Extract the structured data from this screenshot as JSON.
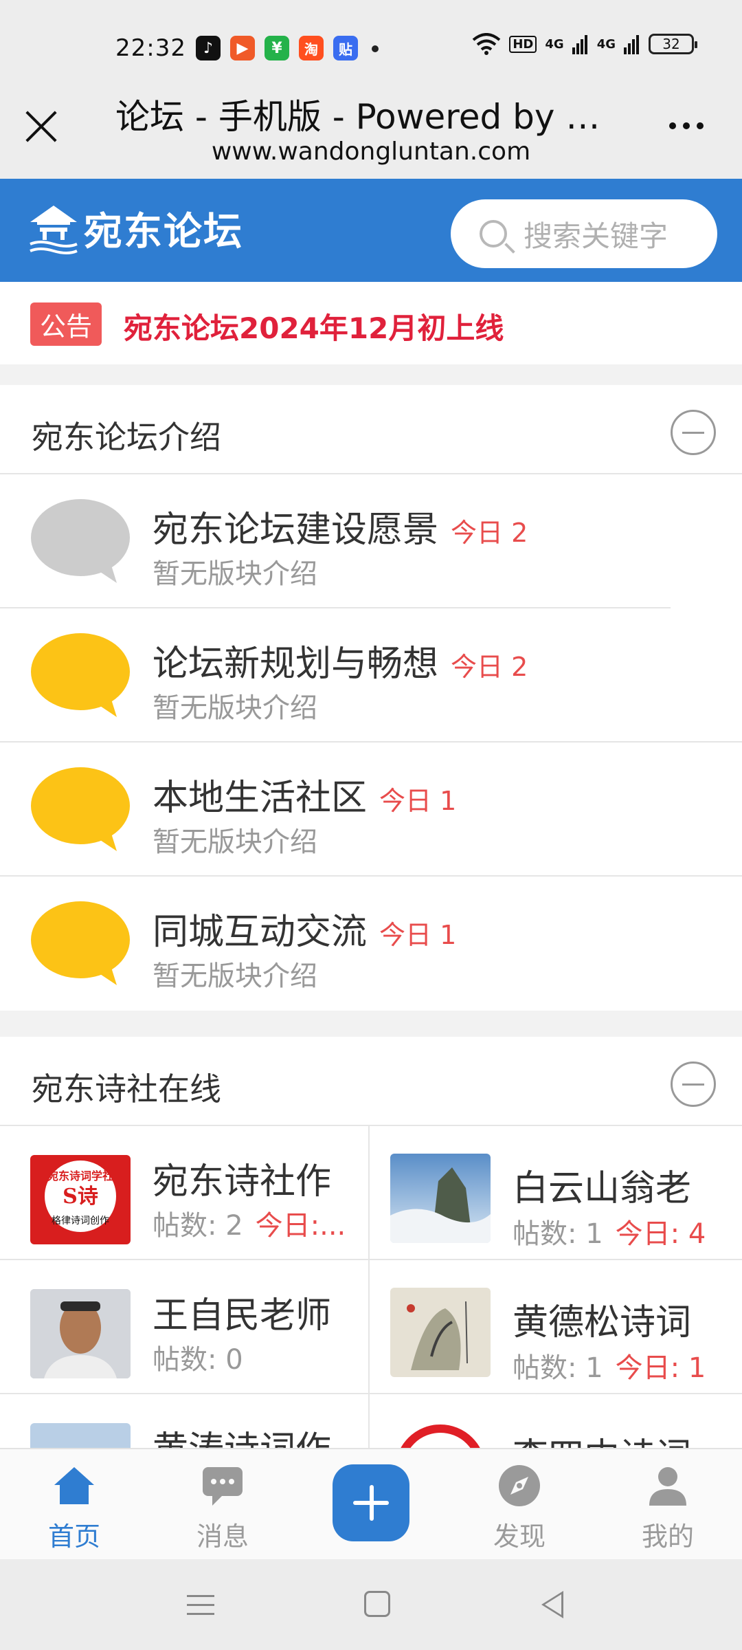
{
  "status_bar": {
    "time": "22:32",
    "apps": [
      {
        "icon": "tiktok-icon",
        "color": "#111111",
        "glyph": "♪"
      },
      {
        "icon": "video-icon",
        "color": "#f05a28",
        "glyph": "▶"
      },
      {
        "icon": "wallet-icon",
        "color": "#24b24a",
        "glyph": "¥"
      },
      {
        "icon": "taobao-icon",
        "color": "#ff4f1f",
        "glyph": "淘"
      },
      {
        "icon": "tieba-icon",
        "color": "#3a6df0",
        "glyph": "贴"
      }
    ],
    "hd_badge": "HD",
    "signal_1": "4G",
    "signal_2": "4G",
    "battery": "32"
  },
  "title_bar": {
    "title": "论坛 - 手机版 - Powered by Di...",
    "url": "www.wandongluntan.com"
  },
  "header": {
    "logo_text": "宛东论坛",
    "search_placeholder": "搜索关键字",
    "brand_color": "#2f7dd1"
  },
  "notice": {
    "tag": "公告",
    "text": "宛东论坛2024年12月初上线"
  },
  "section_intro": {
    "title": "宛东论坛介绍",
    "forums": [
      {
        "name": "宛东论坛建设愿景",
        "today": "今日 2",
        "desc": "暂无版块介绍",
        "bubble_color": "#cccccc"
      },
      {
        "name": "论坛新规划与畅想",
        "today": "今日 2",
        "desc": "暂无版块介绍",
        "bubble_color": "#fcc316"
      },
      {
        "name": "本地生活社区",
        "today": "今日 1",
        "desc": "暂无版块介绍",
        "bubble_color": "#fcc316"
      },
      {
        "name": "同城互动交流",
        "today": "今日 1",
        "desc": "暂无版块介绍",
        "bubble_color": "#fcc316"
      }
    ]
  },
  "section_poetry": {
    "title": "宛东诗社在线",
    "forums": [
      {
        "name": "宛东诗社作",
        "posts": "帖数: 2",
        "today": "今日:...",
        "thumb_label": "宛东诗词学社 格律诗词创作"
      },
      {
        "name": "白云山翁老",
        "posts": "帖数: 1",
        "today": "今日: 4"
      },
      {
        "name": "王自民老师",
        "posts": "帖数: 0",
        "today": ""
      },
      {
        "name": "黄德松诗词",
        "posts": "帖数: 1",
        "today": "今日: 1"
      },
      {
        "name": "黄涛诗词作",
        "posts": "",
        "today": ""
      },
      {
        "name": "李四中诗词",
        "posts": "",
        "today": ""
      }
    ]
  },
  "bottom_nav": {
    "home": "首页",
    "messages": "消息",
    "discover": "发现",
    "profile": "我的"
  }
}
